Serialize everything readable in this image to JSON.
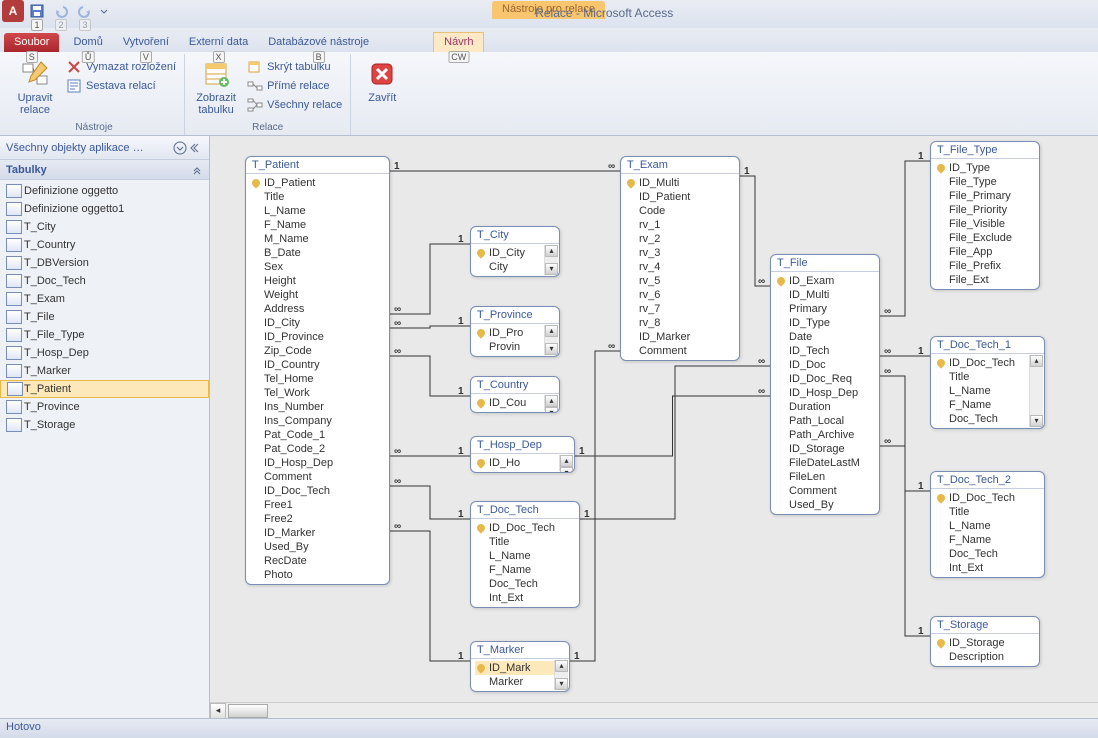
{
  "app": {
    "title": "Relace - Microsoft Access",
    "context_tab": "Nástroje pro relace",
    "qat_keys": [
      "1",
      "2",
      "3"
    ]
  },
  "tabs": {
    "file": "Soubor",
    "file_key": "S",
    "home": "Domů",
    "home_key": "Ů",
    "create": "Vytvoření",
    "create_key": "V",
    "external": "Externí data",
    "external_key": "X",
    "dbtools": "Databázové nástroje",
    "dbtools_key": "B",
    "design": "Návrh",
    "design_key": "CW"
  },
  "ribbon": {
    "group1": {
      "edit": "Upravit relace",
      "clear": "Vymazat rozložení",
      "report": "Sestava relací",
      "label": "Nástroje"
    },
    "group2": {
      "show_table": "Zobrazit tabulku",
      "hide_table": "Skrýt tabulku",
      "direct": "Přímé relace",
      "all": "Všechny relace",
      "label": "Relace"
    },
    "group3": {
      "close": "Zavřít"
    }
  },
  "nav": {
    "header": "Všechny objekty aplikace …",
    "section": "Tabulky",
    "items": [
      "Definizione oggetto",
      "Definizione oggetto1",
      "T_City",
      "T_Country",
      "T_DBVersion",
      "T_Doc_Tech",
      "T_Exam",
      "T_File",
      "T_File_Type",
      "T_Hosp_Dep",
      "T_Marker",
      "T_Patient",
      "T_Province",
      "T_Storage"
    ],
    "selected_index": 11
  },
  "diagram": {
    "tables": {
      "T_Patient": {
        "title": "T_Patient",
        "fields": [
          "ID_Patient",
          "Title",
          "L_Name",
          "F_Name",
          "M_Name",
          "B_Date",
          "Sex",
          "Height",
          "Weight",
          "Address",
          "ID_City",
          "ID_Province",
          "Zip_Code",
          "ID_Country",
          "Tel_Home",
          "Tel_Work",
          "Ins_Number",
          "Ins_Company",
          "Pat_Code_1",
          "Pat_Code_2",
          "ID_Hosp_Dep",
          "Comment",
          "ID_Doc_Tech",
          "Free1",
          "Free2",
          "ID_Marker",
          "Used_By",
          "RecDate",
          "Photo"
        ],
        "pk": [
          0
        ]
      },
      "T_City": {
        "title": "T_City",
        "fields": [
          "ID_City",
          "City"
        ],
        "pk": [
          0
        ]
      },
      "T_Province": {
        "title": "T_Province",
        "fields": [
          "ID_Pro",
          "Provin"
        ],
        "pk": [
          0
        ]
      },
      "T_Country": {
        "title": "T_Country",
        "fields": [
          "ID_Cou"
        ],
        "pk": [
          0
        ]
      },
      "T_Hosp_Dep": {
        "title": "T_Hosp_Dep",
        "fields": [
          "ID_Ho"
        ],
        "pk": [
          0
        ]
      },
      "T_Doc_Tech": {
        "title": "T_Doc_Tech",
        "fields": [
          "ID_Doc_Tech",
          "Title",
          "L_Name",
          "F_Name",
          "Doc_Tech",
          "Int_Ext"
        ],
        "pk": [
          0
        ]
      },
      "T_Marker": {
        "title": "T_Marker",
        "fields": [
          "ID_Mark",
          "Marker"
        ],
        "pk": [
          0
        ],
        "sel": 0
      },
      "T_Exam": {
        "title": "T_Exam",
        "fields": [
          "ID_Multi",
          "ID_Patient",
          "Code",
          "rv_1",
          "rv_2",
          "rv_3",
          "rv_4",
          "rv_5",
          "rv_6",
          "rv_7",
          "rv_8",
          "ID_Marker",
          "Comment"
        ],
        "pk": [
          0
        ]
      },
      "T_File": {
        "title": "T_File",
        "fields": [
          "ID_Exam",
          "ID_Multi",
          "Primary",
          "ID_Type",
          "Date",
          "ID_Tech",
          "ID_Doc",
          "ID_Doc_Req",
          "ID_Hosp_Dep",
          "Duration",
          "Path_Local",
          "Path_Archive",
          "ID_Storage",
          "FileDateLastM",
          "FileLen",
          "Comment",
          "Used_By"
        ],
        "pk": [
          0
        ]
      },
      "T_File_Type": {
        "title": "T_File_Type",
        "fields": [
          "ID_Type",
          "File_Type",
          "File_Primary",
          "File_Priority",
          "File_Visible",
          "File_Exclude",
          "File_App",
          "File_Prefix",
          "File_Ext"
        ],
        "pk": [
          0
        ]
      },
      "T_Doc_Tech_1": {
        "title": "T_Doc_Tech_1",
        "fields": [
          "ID_Doc_Tech",
          "Title",
          "L_Name",
          "F_Name",
          "Doc_Tech"
        ],
        "pk": [
          0
        ]
      },
      "T_Doc_Tech_2": {
        "title": "T_Doc_Tech_2",
        "fields": [
          "ID_Doc_Tech",
          "Title",
          "L_Name",
          "F_Name",
          "Doc_Tech",
          "Int_Ext"
        ],
        "pk": [
          0
        ]
      },
      "T_Storage": {
        "title": "T_Storage",
        "fields": [
          "ID_Storage",
          "Description"
        ],
        "pk": [
          0
        ]
      }
    }
  },
  "status": {
    "text": "Hotovo"
  },
  "labels": {
    "one": "1",
    "inf": "∞"
  }
}
